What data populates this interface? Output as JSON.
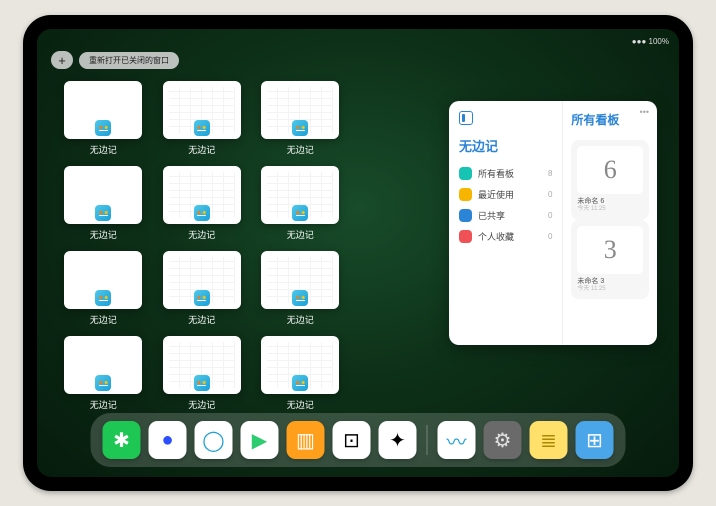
{
  "status": {
    "time": "",
    "battery": "100%",
    "wifi": "●●●"
  },
  "top": {
    "plus": "+",
    "reopen": "重新打开已关闭的窗口"
  },
  "windows": [
    {
      "label": "无边记",
      "detailed": false
    },
    {
      "label": "无边记",
      "detailed": true
    },
    {
      "label": "无边记",
      "detailed": true
    },
    null,
    {
      "label": "无边记",
      "detailed": false
    },
    {
      "label": "无边记",
      "detailed": true
    },
    {
      "label": "无边记",
      "detailed": true
    },
    null,
    {
      "label": "无边记",
      "detailed": false
    },
    {
      "label": "无边记",
      "detailed": true
    },
    {
      "label": "无边记",
      "detailed": true
    },
    null,
    {
      "label": "无边记",
      "detailed": false
    },
    {
      "label": "无边记",
      "detailed": true
    },
    {
      "label": "无边记",
      "detailed": true
    },
    null
  ],
  "panel": {
    "leftTitle": "无边记",
    "rightTitle": "所有看板",
    "nav": [
      {
        "label": "所有看板",
        "color": "#17c3b2",
        "count": "8"
      },
      {
        "label": "最近使用",
        "color": "#f7b500",
        "count": "0"
      },
      {
        "label": "已共享",
        "color": "#2b84d6",
        "count": "0"
      },
      {
        "label": "个人收藏",
        "color": "#f05156",
        "count": "0"
      }
    ],
    "boards": [
      {
        "glyph": "6",
        "name": "未命名 6",
        "time": "今天 11:25"
      },
      {
        "glyph": "3",
        "name": "未命名 3",
        "time": "今天 11:25"
      }
    ]
  },
  "dock": [
    {
      "name": "wechat",
      "bg": "#1ec754",
      "glyph": "✱",
      "fg": "#fff"
    },
    {
      "name": "browser1",
      "bg": "#ffffff",
      "glyph": "●",
      "fg": "#2b4fff"
    },
    {
      "name": "browser2",
      "bg": "#ffffff",
      "glyph": "◯",
      "fg": "#1b9fd6"
    },
    {
      "name": "play",
      "bg": "#ffffff",
      "glyph": "▶",
      "fg": "#2ecc71"
    },
    {
      "name": "books",
      "bg": "#ff9f1c",
      "glyph": "▥",
      "fg": "#fff"
    },
    {
      "name": "dice",
      "bg": "#ffffff",
      "glyph": "⊡",
      "fg": "#000"
    },
    {
      "name": "graph",
      "bg": "#ffffff",
      "glyph": "✦",
      "fg": "#000"
    },
    {
      "name": "freeform",
      "bg": "#ffffff",
      "glyph": "〰",
      "fg": "#1b9fd6"
    },
    {
      "name": "settings",
      "bg": "#6a6a6a",
      "glyph": "⚙",
      "fg": "#e0e0e0"
    },
    {
      "name": "notes",
      "bg": "#ffe06b",
      "glyph": "≣",
      "fg": "#aa8800"
    },
    {
      "name": "apps",
      "bg": "#4aa6e8",
      "glyph": "⊞",
      "fg": "#fff"
    }
  ]
}
